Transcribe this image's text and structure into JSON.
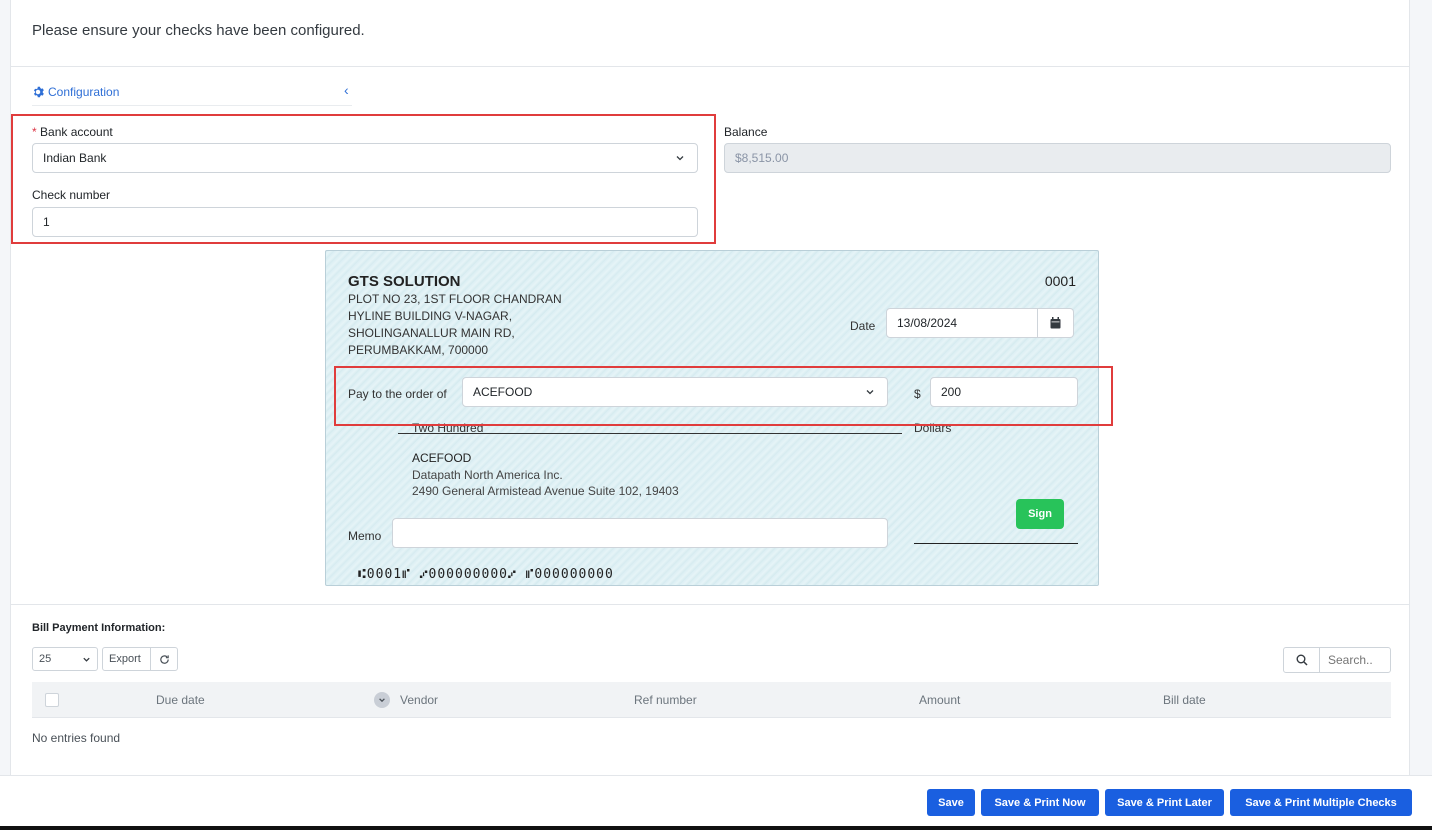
{
  "notice": "Please ensure your checks have been configured.",
  "config": {
    "label": "Configuration",
    "collapse_icon": "chevron-left-icon"
  },
  "form": {
    "bank_account_label": "Bank account",
    "required_mark": "*",
    "bank_account_value": "Indian Bank",
    "check_number_label": "Check number",
    "check_number_value": "1",
    "balance_label": "Balance",
    "balance_value": "$8,515.00"
  },
  "check": {
    "company": "GTS SOLUTION",
    "address_lines": [
      "PLOT NO 23, 1ST FLOOR CHANDRAN",
      "HYLINE BUILDING V-NAGAR,",
      "SHOLINGANALLUR MAIN RD,",
      "PERUMBAKKAM, 700000"
    ],
    "check_no": "0001",
    "date_label": "Date",
    "date_value": "13/08/2024",
    "pay_label": "Pay to the order of",
    "payee": "ACEFOOD",
    "currency": "$",
    "amount": "200",
    "amount_words": "Two Hundred",
    "dollars_label": "Dollars",
    "payee_name": "ACEFOOD",
    "payee_address": [
      "Datapath North America Inc.",
      "2490 General Armistead Avenue Suite 102, 19403"
    ],
    "memo_label": "Memo",
    "memo_value": "",
    "sign_label": "Sign",
    "micr": "⑆0001⑈  ⑇000000000⑇  ⑈000000000"
  },
  "bills": {
    "title": "Bill Payment Information:",
    "page_size": "25",
    "export_label": "Export",
    "search_placeholder": "Search..",
    "columns": [
      "Due date",
      "Vendor",
      "Ref number",
      "Amount",
      "Bill date"
    ],
    "empty_text": "No entries found"
  },
  "footer": {
    "save": "Save",
    "save_print_now": "Save & Print Now",
    "save_print_later": "Save & Print Later",
    "save_print_multiple": "Save & Print Multiple Checks"
  },
  "colors": {
    "primary": "#1a5fe0",
    "success": "#28c35a",
    "highlight": "#e03c3c",
    "link": "#2f6fd6"
  }
}
